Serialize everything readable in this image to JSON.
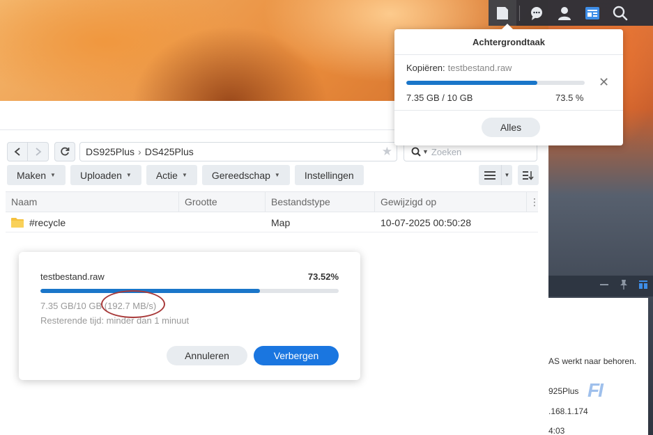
{
  "background_task": {
    "title": "Achtergrondtaak",
    "task_label": "Kopiëren:",
    "file_name": "testbestand.raw",
    "progress_fraction": 0.735,
    "size_text": "7.35 GB / 10 GB",
    "percent_text": "73.5 %",
    "all_button": "Alles"
  },
  "file_station": {
    "path": [
      "DS925Plus",
      "DS425Plus"
    ],
    "search_placeholder": "Zoeken",
    "toolbar": {
      "create": "Maken",
      "upload": "Uploaden",
      "action": "Actie",
      "tools": "Gereedschap",
      "settings": "Instellingen"
    },
    "columns": [
      "Naam",
      "Grootte",
      "Bestandstype",
      "Gewijzigd op"
    ],
    "rows": [
      {
        "name": "#recycle",
        "size": "",
        "type": "Map",
        "modified": "10-07-2025 00:50:28"
      }
    ]
  },
  "copy_dialog": {
    "file_name": "testbestand.raw",
    "percent_text": "73.52%",
    "progress_fraction": 0.7352,
    "progress_text": "7.35 GB/10 GB (192.7 MB/s)",
    "remaining_text": "Resterende tijd: minder dan 1 minuut",
    "cancel_button": "Annuleren",
    "hide_button": "Verbergen"
  },
  "side_widget": {
    "lines": [
      "AS werkt naar behoren.",
      "925Plus",
      ".168.1.174",
      "4:03"
    ]
  },
  "watermark": "FI",
  "colors": {
    "accent": "#1a76c9",
    "primary_button": "#1a76e0",
    "taskbar": "#262c37",
    "highlight_circle": "#a83a3a"
  }
}
